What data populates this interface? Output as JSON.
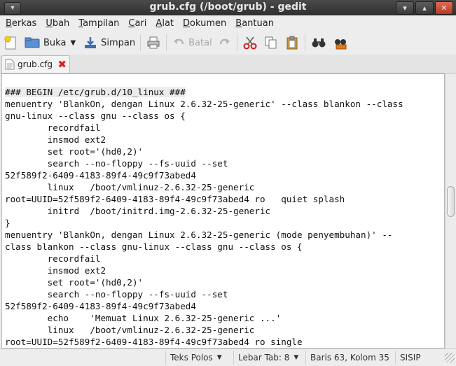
{
  "window": {
    "title": "grub.cfg (/boot/grub) - gedit",
    "controls": [
      "minimize",
      "maximize",
      "close"
    ]
  },
  "menubar": {
    "items": [
      {
        "label": "Berkas",
        "mnemonic": "B",
        "rest": "erkas"
      },
      {
        "label": "Ubah",
        "mnemonic": "U",
        "rest": "bah"
      },
      {
        "label": "Tampilan",
        "mnemonic": "T",
        "rest": "ampilan"
      },
      {
        "label": "Cari",
        "mnemonic": "C",
        "rest": "ari"
      },
      {
        "label": "Alat",
        "mnemonic": "A",
        "rest": "lat"
      },
      {
        "label": "Dokumen",
        "mnemonic": "D",
        "rest": "okumen"
      },
      {
        "label": "Bantuan",
        "mnemonic": "B",
        "rest": "antuan"
      }
    ]
  },
  "toolbar": {
    "open_label": "Buka",
    "save_label": "Simpan",
    "undo_label": "Batal"
  },
  "tab": {
    "filename": "grub.cfg"
  },
  "editor": {
    "highlight_line": "### BEGIN /etc/grub.d/10_linux ###",
    "lines": [
      "menuentry 'BlankOn, dengan Linux 2.6.32-25-generic' --class blankon --class",
      "gnu-linux --class gnu --class os {",
      "        recordfail",
      "        insmod ext2",
      "        set root='(hd0,2)'",
      "        search --no-floppy --fs-uuid --set",
      "52f589f2-6409-4183-89f4-49c9f73abed4",
      "        linux   /boot/vmlinuz-2.6.32-25-generic",
      "root=UUID=52f589f2-6409-4183-89f4-49c9f73abed4 ro   quiet splash",
      "        initrd  /boot/initrd.img-2.6.32-25-generic",
      "}",
      "menuentry 'BlankOn, dengan Linux 2.6.32-25-generic (mode penyembuhan)' --",
      "class blankon --class gnu-linux --class gnu --class os {",
      "        recordfail",
      "        insmod ext2",
      "        set root='(hd0,2)'",
      "        search --no-floppy --fs-uuid --set",
      "52f589f2-6409-4183-89f4-49c9f73abed4",
      "        echo    'Memuat Linux 2.6.32-25-generic ...'",
      "        linux   /boot/vmlinuz-2.6.32-25-generic",
      "root=UUID=52f589f2-6409-4183-89f4-49c9f73abed4 ro single"
    ]
  },
  "statusbar": {
    "language": "Teks Polos",
    "tab_width": "Lebar Tab:  8",
    "position": "Baris 63, Kolom 35",
    "mode": "SISIP"
  }
}
